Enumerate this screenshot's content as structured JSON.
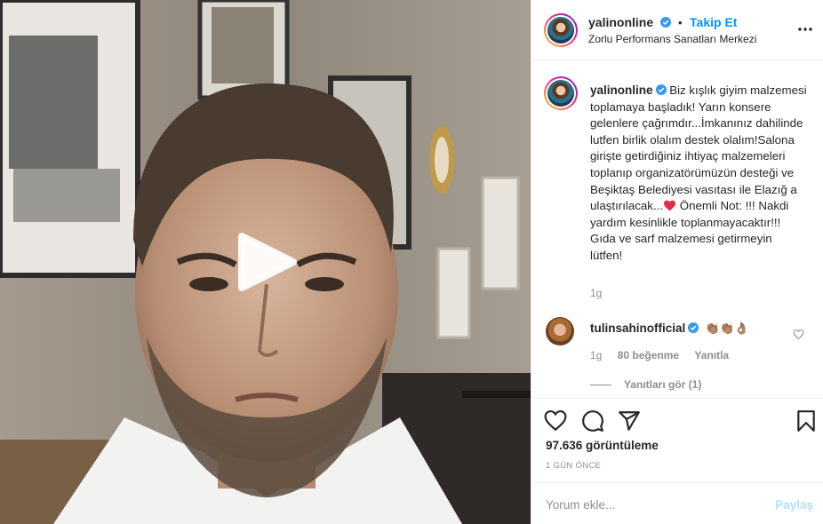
{
  "post": {
    "username": "yalinonline",
    "follow_label": "Takip Et",
    "separator": "•",
    "location": "Zorlu Performans Sanatları Merkezi",
    "caption_parts": [
      "Biz kışlık giyim malzemesi toplamaya başladık! Yarın konsere gelenlere çağrımdır...İmkanınız dahilinde lutfen birlik olalım destek olalım!Salona girişte getirdiğiniz ihtiyaç malzemeleri toplanıp organizatörümüzün desteği ve Beşiktaş Belediyesi vasıtası ile Elazığ a ulaştırılacak...",
      " Önemli Not: !!! Nakdi yardım kesinlikle toplanmayacaktır!!! Gıda ve sarf malzemesi getirmeyin lütfen!"
    ],
    "caption_time": "1g",
    "views": "97.636 görüntüleme",
    "date": "1 GÜN ÖNCE"
  },
  "reply": {
    "username": "tulinsahinofficial",
    "emojis": "👏🏽👏🏽👌🏽",
    "time": "1g",
    "likes": "80 beğenme",
    "reply_label": "Yanıtla",
    "view_replies": "Yanıtları gör (1)"
  },
  "comment_box": {
    "placeholder": "Yorum ekle...",
    "post_label": "Paylaş"
  },
  "icons": {
    "verified": "verified-badge-icon",
    "more": "more-options-icon",
    "like": "heart-icon",
    "comment": "comment-icon",
    "share": "share-icon",
    "save": "bookmark-icon",
    "play": "play-icon"
  },
  "colors": {
    "accent": "#0095f6",
    "secondary_text": "#8e8e8e",
    "heart": "#ed4956",
    "post_disabled": "#b2dffc"
  }
}
